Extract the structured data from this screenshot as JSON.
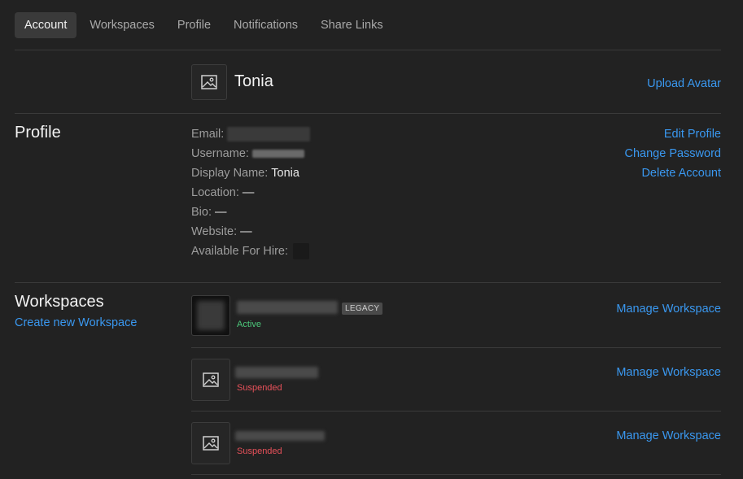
{
  "tabs": [
    {
      "label": "Account",
      "active": true
    },
    {
      "label": "Workspaces",
      "active": false
    },
    {
      "label": "Profile",
      "active": false
    },
    {
      "label": "Notifications",
      "active": false
    },
    {
      "label": "Share Links",
      "active": false
    }
  ],
  "header": {
    "display_name": "Tonia",
    "upload_avatar": "Upload Avatar"
  },
  "profile": {
    "title": "Profile",
    "actions": {
      "edit": "Edit Profile",
      "change_password": "Change Password",
      "delete": "Delete Account"
    },
    "fields": {
      "email_label": "Email:",
      "username_label": "Username:",
      "display_name_label": "Display Name:",
      "display_name_value": "Tonia",
      "location_label": "Location:",
      "location_value": "—",
      "bio_label": "Bio:",
      "bio_value": "—",
      "website_label": "Website:",
      "website_value": "—",
      "hire_label": "Available For Hire:"
    }
  },
  "workspaces": {
    "title": "Workspaces",
    "create_link": "Create new Workspace",
    "items": [
      {
        "badge": "LEGACY",
        "status": "Active",
        "manage": "Manage Workspace"
      },
      {
        "status": "Suspended",
        "manage": "Manage Workspace"
      },
      {
        "status": "Suspended",
        "manage": "Manage Workspace"
      }
    ]
  },
  "colors": {
    "background": "#222222",
    "link": "#3a98f0",
    "active_status": "#4cc77a",
    "suspended_status": "#e8515a"
  }
}
